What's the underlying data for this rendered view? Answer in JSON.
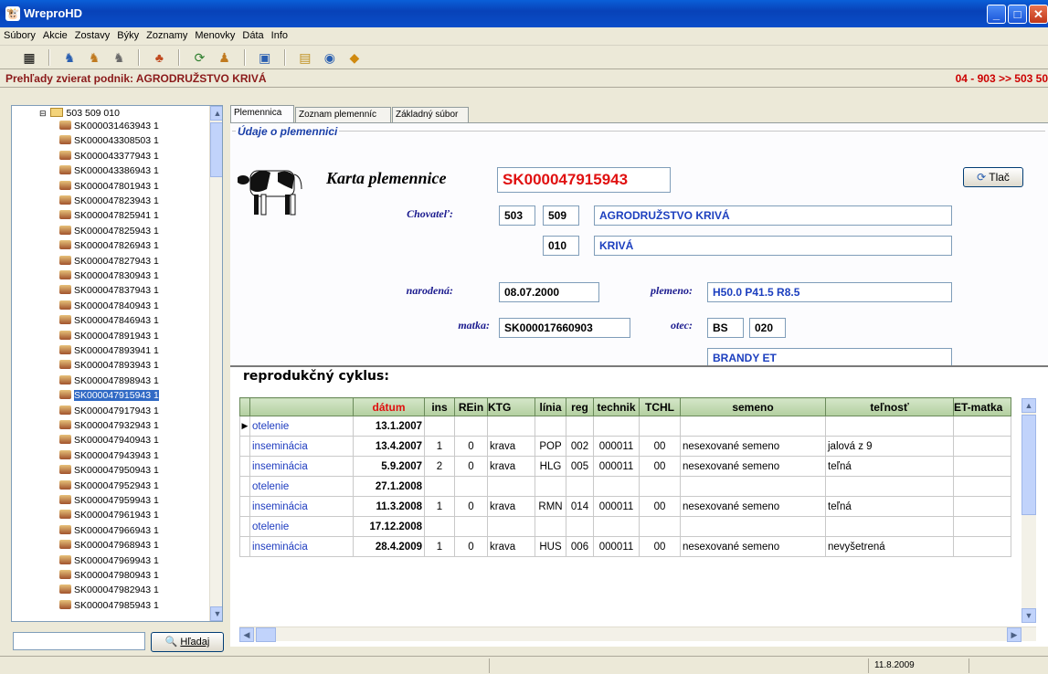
{
  "window": {
    "title": "WreproHD",
    "app_icon": "cow-icon"
  },
  "menu": [
    "Súbory",
    "Akcie",
    "Zostavy",
    "Býky",
    "Zoznamy",
    "Menovky",
    "Dáta",
    "Info"
  ],
  "header": {
    "title": "Prehľady zvierat  podnik: AGRODRUŽSTVO KRIVÁ",
    "right": "04 - 903  >>  503 50"
  },
  "tree": {
    "root": "503 509 010",
    "items": [
      "SK000031463943 1",
      "SK000043308503 1",
      "SK000043377943 1",
      "SK000043386943 1",
      "SK000047801943 1",
      "SK000047823943 1",
      "SK000047825941 1",
      "SK000047825943 1",
      "SK000047826943 1",
      "SK000047827943 1",
      "SK000047830943 1",
      "SK000047837943 1",
      "SK000047840943 1",
      "SK000047846943 1",
      "SK000047891943 1",
      "SK000047893941 1",
      "SK000047893943 1",
      "SK000047898943 1",
      "SK000047915943 1",
      "SK000047917943 1",
      "SK000047932943 1",
      "SK000047940943 1",
      "SK000047943943 1",
      "SK000047950943 1",
      "SK000047952943 1",
      "SK000047959943 1",
      "SK000047961943 1",
      "SK000047966943 1",
      "SK000047968943 1",
      "SK000047969943 1",
      "SK000047980943 1",
      "SK000047982943 1",
      "SK000047985943 1"
    ],
    "selected": "SK000047915943 1"
  },
  "search": {
    "button": "Hľadaj",
    "value": ""
  },
  "tabs": [
    "Plemennica",
    "Zoznam plemenníc",
    "Základný súbor"
  ],
  "card": {
    "section_title": "Údaje o plemennici",
    "title": "Karta plemennice",
    "id": "SK000047915943",
    "print_button": "Tlač",
    "breeder_label": "Chovateľ:",
    "breeder_code1": "503",
    "breeder_code2": "509",
    "breeder_name": "AGRODRUŽSTVO KRIVÁ",
    "breeder_code3": "010",
    "breeder_place": "KRIVÁ",
    "born_label": "narodená:",
    "born": "08.07.2000",
    "breed_label": "plemeno:",
    "breed": "H50.0  P41.5  R8.5",
    "mother_label": "matka:",
    "mother": "SK000017660903",
    "father_label": "otec:",
    "father_code1": "BS",
    "father_code2": "020",
    "father_name": "BRANDY ET"
  },
  "grid": {
    "title": "reprodukčný cyklus:",
    "columns": [
      "",
      "dátum",
      "ins",
      "REin",
      "KTG",
      "línia",
      "reg",
      "technik",
      "TCHL",
      "semeno",
      "teľnosť",
      "ET-matka"
    ],
    "rows": [
      {
        "type": "otelenie",
        "date": "13.1.2007",
        "ins": "",
        "rein": "",
        "ktg": "",
        "linia": "",
        "reg": "",
        "technik": "",
        "tchl": "",
        "semeno": "",
        "telnost": ""
      },
      {
        "type": "inseminácia",
        "date": "13.4.2007",
        "ins": "1",
        "rein": "0",
        "ktg": "krava",
        "linia": "POP",
        "reg": "002",
        "technik": "000011",
        "tchl": "00",
        "semeno": "nesexované semeno",
        "telnost": "jalová z 9"
      },
      {
        "type": "inseminácia",
        "date": "5.9.2007",
        "ins": "2",
        "rein": "0",
        "ktg": "krava",
        "linia": "HLG",
        "reg": "005",
        "technik": "000011",
        "tchl": "00",
        "semeno": "nesexované semeno",
        "telnost": "teľná"
      },
      {
        "type": "otelenie",
        "date": "27.1.2008",
        "ins": "",
        "rein": "",
        "ktg": "",
        "linia": "",
        "reg": "",
        "technik": "",
        "tchl": "",
        "semeno": "",
        "telnost": ""
      },
      {
        "type": "inseminácia",
        "date": "11.3.2008",
        "ins": "1",
        "rein": "0",
        "ktg": "krava",
        "linia": "RMN",
        "reg": "014",
        "technik": "000011",
        "tchl": "00",
        "semeno": "nesexované semeno",
        "telnost": "teľná"
      },
      {
        "type": "otelenie",
        "date": "17.12.2008",
        "ins": "",
        "rein": "",
        "ktg": "",
        "linia": "",
        "reg": "",
        "technik": "",
        "tchl": "",
        "semeno": "",
        "telnost": ""
      },
      {
        "type": "inseminácia",
        "date": "28.4.2009",
        "ins": "1",
        "rein": "0",
        "ktg": "krava",
        "linia": "HUS",
        "reg": "006",
        "technik": "000011",
        "tchl": "00",
        "semeno": "nesexované semeno",
        "telnost": "nevyšetrená"
      }
    ]
  },
  "status": {
    "date": "11.8.2009"
  },
  "colors": {
    "accent_red": "#cc0000",
    "accent_blue": "#1c3fbf",
    "header_dark_red": "#8b1a1a",
    "grid_header_green": "#b3cfa0"
  }
}
